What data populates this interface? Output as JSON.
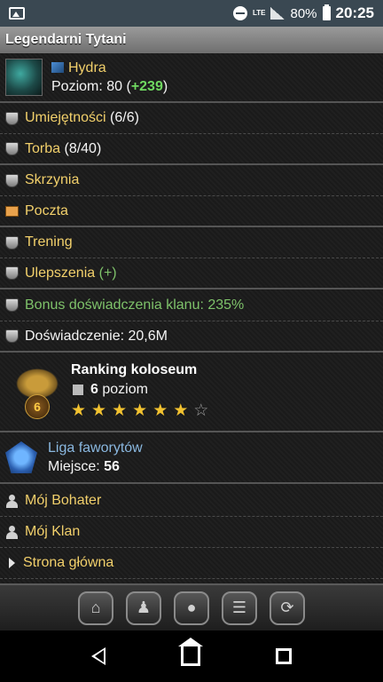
{
  "status_bar": {
    "network": "LTE",
    "battery": "80%",
    "time": "20:25"
  },
  "title": "Legendarni Tytani",
  "hero": {
    "name": "Hydra",
    "level_label": "Poziom: 80 (",
    "level_bonus": "+239",
    "level_close": ")"
  },
  "menu": {
    "skills_label": "Umiejętności",
    "skills_count": "(6/6)",
    "bag_label": "Torba",
    "bag_count": "(8/40)",
    "chest_label": "Skrzynia",
    "mail_label": "Poczta",
    "training_label": "Trening",
    "upgrades_label": "Ulepszenia",
    "upgrades_extra": "(+)",
    "clan_bonus": "Bonus doświadczenia klanu: 235%",
    "experience": "Doświadczenie: 20,6M"
  },
  "coliseum": {
    "title": "Ranking koloseum",
    "badge_number": "6",
    "level_value": "6",
    "level_label": "poziom",
    "stars_filled": 6,
    "stars_total": 7
  },
  "league": {
    "name": "Liga faworytów",
    "place_label": "Miejsce:",
    "place_value": "56"
  },
  "links": {
    "my_hero": "Mój Bohater",
    "my_clan": "Mój Klan",
    "home": "Strona główna"
  },
  "toolbar": {
    "buttons": [
      "home-icon",
      "person-icon",
      "coins-icon",
      "list-icon",
      "refresh-icon"
    ]
  },
  "colors": {
    "gold": "#f2d06b",
    "green": "#7ec26a",
    "bonus_green": "#6fd860"
  }
}
